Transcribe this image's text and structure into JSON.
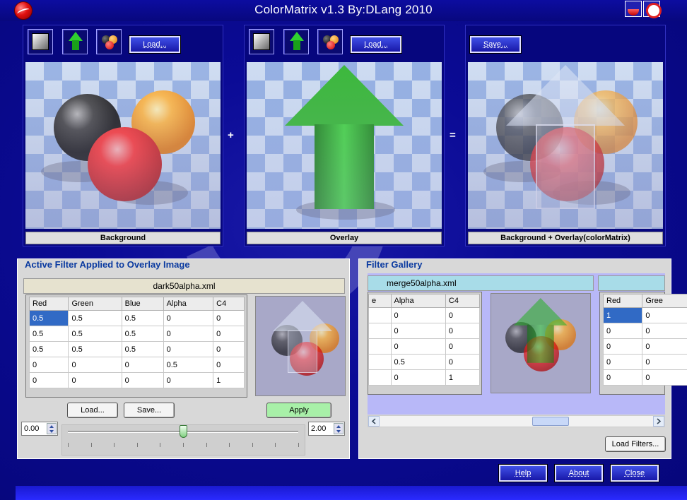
{
  "window": {
    "title": "ColorMatrix v1.3 By:DLang 2010"
  },
  "panels": {
    "background": {
      "caption": "Background",
      "load_label": "Load..."
    },
    "overlay": {
      "caption": "Overlay",
      "load_label": "Load..."
    },
    "result": {
      "caption": "Background + Overlay(colorMatrix)",
      "save_label": "Save..."
    },
    "plus": "+",
    "equals": "="
  },
  "active_filter": {
    "title": "Active Filter Applied to Overlay Image",
    "filename": "dark50alpha.xml",
    "columns": [
      "Red",
      "Green",
      "Blue",
      "Alpha",
      "C4"
    ],
    "rows": [
      [
        "0.5",
        "0.5",
        "0.5",
        "0",
        "0"
      ],
      [
        "0.5",
        "0.5",
        "0.5",
        "0",
        "0"
      ],
      [
        "0.5",
        "0.5",
        "0.5",
        "0",
        "0"
      ],
      [
        "0",
        "0",
        "0",
        "0.5",
        "0"
      ],
      [
        "0",
        "0",
        "0",
        "0",
        "1"
      ]
    ],
    "load_label": "Load...",
    "save_label": "Save...",
    "apply_label": "Apply",
    "min_value": "0.00",
    "max_value": "2.00",
    "slider_position": 0.5
  },
  "gallery": {
    "title": "Filter Gallery",
    "item1": {
      "filename": "merge50alpha.xml",
      "columns": [
        "e",
        "Alpha",
        "C4"
      ],
      "rows": [
        [
          "",
          "0",
          "0"
        ],
        [
          "",
          "0",
          "0"
        ],
        [
          "",
          "0",
          "0"
        ],
        [
          "",
          "0.5",
          "0"
        ],
        [
          "",
          "0",
          "1"
        ]
      ]
    },
    "item2": {
      "columns": [
        "Red",
        "Gree"
      ],
      "rows": [
        [
          "1",
          "0"
        ],
        [
          "0",
          "0"
        ],
        [
          "0",
          "0"
        ],
        [
          "0",
          "0"
        ],
        [
          "0",
          "0"
        ]
      ]
    },
    "load_filters_label": "Load Filters..."
  },
  "footer": {
    "help_label": "Help",
    "about_label": "About",
    "close_label": "Close"
  }
}
